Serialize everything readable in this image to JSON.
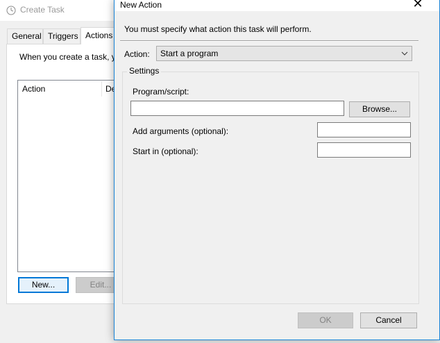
{
  "create_task": {
    "title": "Create Task",
    "tabs": [
      {
        "label": "General"
      },
      {
        "label": "Triggers"
      },
      {
        "label": "Actions"
      }
    ],
    "intro_text": "When you create a task, y",
    "list_columns": [
      "Action",
      "De"
    ],
    "buttons": {
      "new": "New...",
      "edit": "Edit..."
    }
  },
  "new_action": {
    "title": "New Action",
    "close_glyph": "✕",
    "instruction": "You must specify what action this task will perform.",
    "action_label": "Action:",
    "action_value": "Start a program",
    "settings_legend": "Settings",
    "program_label": "Program/script:",
    "program_value": "",
    "browse_label": "Browse...",
    "args_label": "Add arguments (optional):",
    "args_value": "",
    "startin_label": "Start in (optional):",
    "startin_value": "",
    "ok_label": "OK",
    "cancel_label": "Cancel"
  },
  "icons": {
    "create_task_icon": "clock-icon",
    "select_chevron": "chevron-down-icon",
    "close": "close-icon"
  },
  "colors": {
    "accent": "#0078d7",
    "dialog_border": "#1883d7",
    "window_bg": "#f0f0f0",
    "disabled_text": "#838383"
  }
}
